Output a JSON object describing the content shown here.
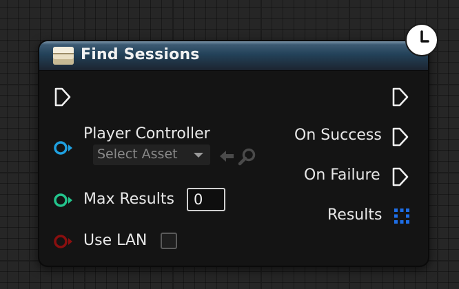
{
  "node": {
    "title": "Find Sessions",
    "header_color": "#234259"
  },
  "inputs": {
    "player_controller": {
      "label": "Player Controller",
      "color": "#1fa0e0",
      "select_asset_label": "Select Asset"
    },
    "max_results": {
      "label": "Max Results",
      "value": "0",
      "color": "#23c48c"
    },
    "use_lan": {
      "label": "Use LAN",
      "color": "#8a0f0f",
      "checked": false
    }
  },
  "outputs": {
    "on_success": {
      "label": "On Success"
    },
    "on_failure": {
      "label": "On Failure"
    },
    "results": {
      "label": "Results",
      "color": "#1e6ee6"
    }
  },
  "icons": {
    "latent": "clock-icon",
    "use_selected": "arrow-left-icon",
    "browse": "search-icon"
  }
}
